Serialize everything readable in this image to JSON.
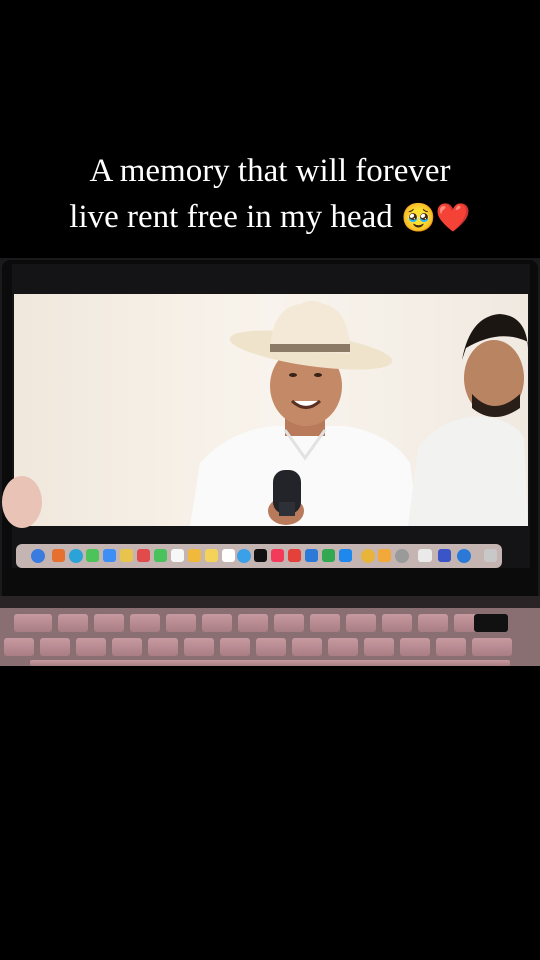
{
  "caption": {
    "line1": "A memory that will forever",
    "line2": "live rent free in my head",
    "emojis": "🥹❤️"
  },
  "photo": {
    "subject": "laptop screen showing a smiling man in a white cowboy hat and white shirt speaking into a microphone, another man beside him; macOS dock and pink keyboard visible",
    "icons": [
      "laptop-icon",
      "cowboy-hat-icon",
      "microphone-icon"
    ]
  }
}
